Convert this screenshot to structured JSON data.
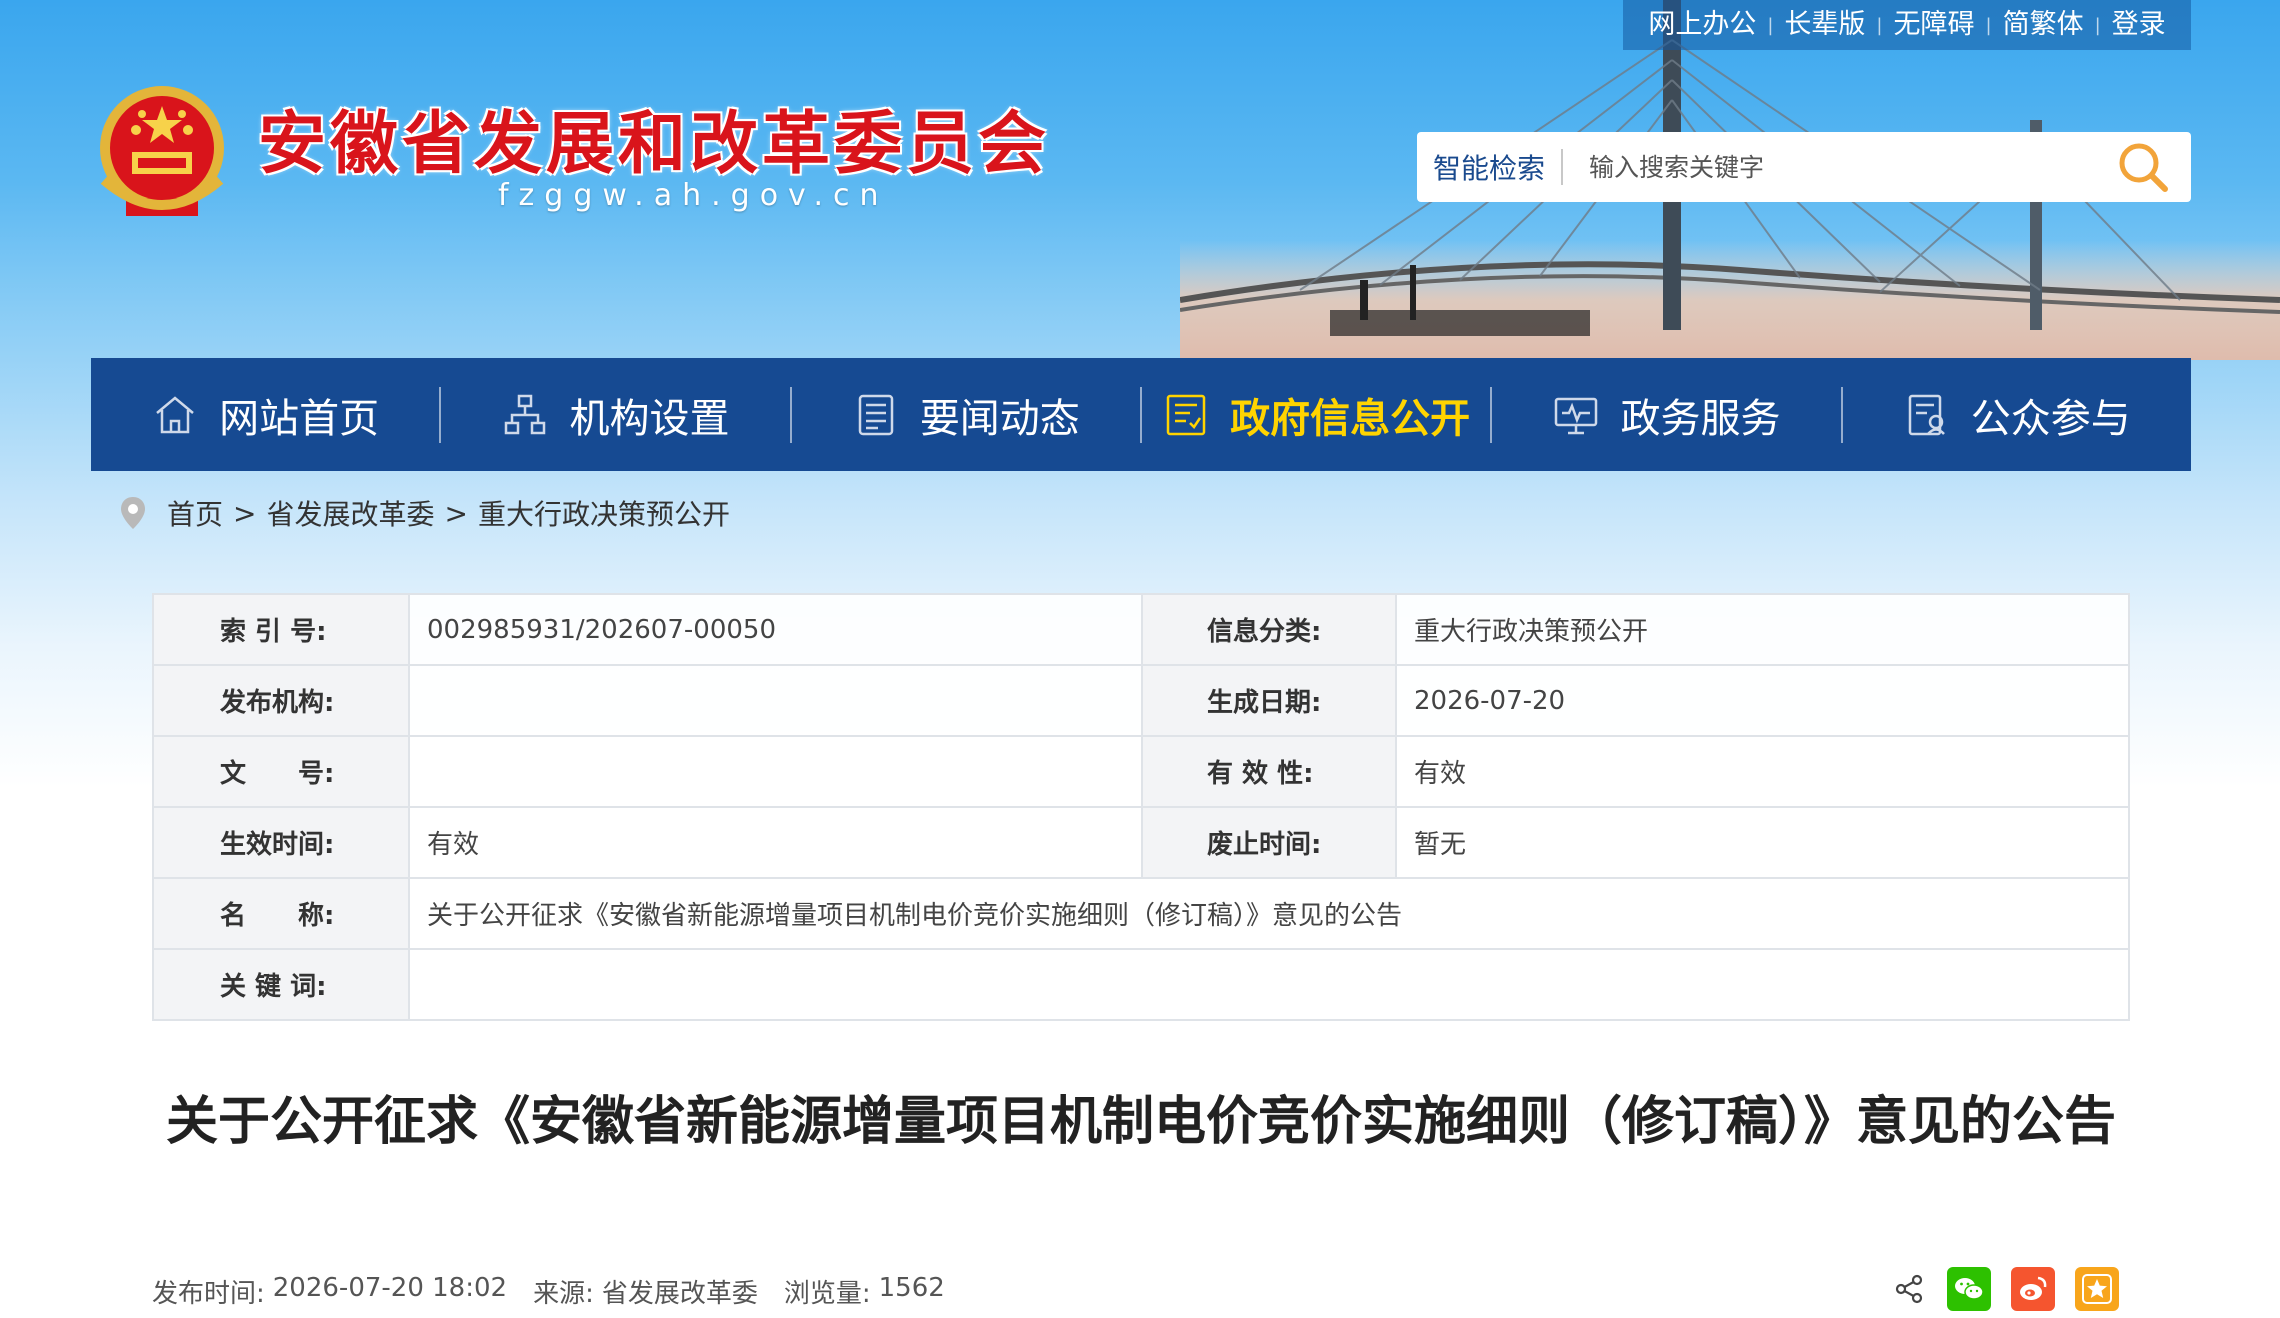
{
  "topbar": {
    "links": [
      "网上办公",
      "长辈版",
      "无障碍",
      "简繁体",
      "登录"
    ]
  },
  "header": {
    "title": "安徽省发展和改革委员会",
    "domain": "fzggw.ah.gov.cn",
    "title_color": "#d9141b"
  },
  "search": {
    "label": "智能检索",
    "placeholder": "输入搜索关键字",
    "icon": "search-icon",
    "icon_color": "#f2a43a"
  },
  "nav": {
    "background": "#164a92",
    "active_color": "#ffd400",
    "items": [
      {
        "label": "网站首页",
        "icon": "home-icon"
      },
      {
        "label": "机构设置",
        "icon": "org-chart-icon"
      },
      {
        "label": "要闻动态",
        "icon": "news-icon"
      },
      {
        "label": "政府信息公开",
        "icon": "document-icon",
        "active": true
      },
      {
        "label": "政务服务",
        "icon": "monitor-icon"
      },
      {
        "label": "公众参与",
        "icon": "participation-icon"
      }
    ]
  },
  "breadcrumb": {
    "icon": "location-pin-icon",
    "items": [
      "首页",
      "省发展改革委",
      "重大行政决策预公开"
    ],
    "separator": ">"
  },
  "meta": {
    "rows": [
      {
        "k1": "索 引 号:",
        "v1": "002985931/202607-00050",
        "k2": "信息分类:",
        "v2": "重大行政决策预公开"
      },
      {
        "k1": "发布机构:",
        "v1": "",
        "k2": "生成日期:",
        "v2": "2026-07-20"
      },
      {
        "k1": "文　　号:",
        "v1": "",
        "k2": "有 效 性:",
        "v2": "有效"
      },
      {
        "k1": "生效时间:",
        "v1": "有效",
        "k2": "废止时间:",
        "v2": "暂无"
      }
    ],
    "name_label": "名　　称:",
    "name_value": "关于公开征求《安徽省新能源增量项目机制电价竞价实施细则（修订稿）》意见的公告",
    "keyword_label": "关 键 词:",
    "keyword_value": ""
  },
  "article": {
    "title": "关于公开征求《安徽省新能源增量项目机制电价竞价实施细则（修订稿）》意见的公告",
    "publish_label": "发布时间:",
    "publish_time": "2026-07-20 18:02",
    "source_label": "来源:",
    "source": "省发展改革委",
    "views_label": "浏览量:",
    "views": "1562"
  },
  "share": {
    "icons": [
      "share-icon",
      "wechat-icon",
      "weibo-icon",
      "favorite-icon"
    ],
    "colors": {
      "wechat": "#2dc100",
      "weibo": "#f5552f",
      "favorite": "#f8a51b"
    }
  }
}
